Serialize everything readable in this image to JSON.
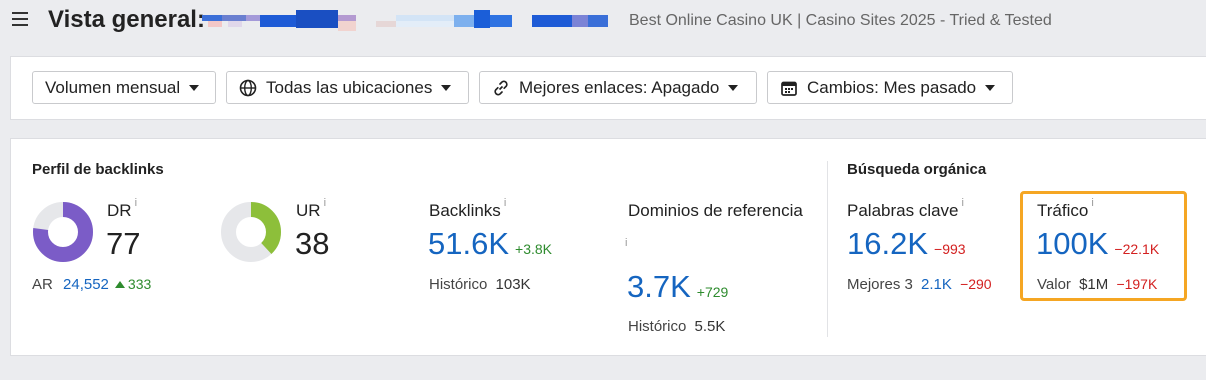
{
  "header": {
    "title": "Vista general:",
    "subtitle": "Best Online Casino UK | Casino Sites 2025 - Tried & Tested"
  },
  "filters": [
    {
      "label": "Volumen mensual",
      "icon": "none"
    },
    {
      "label": "Todas las ubicaciones",
      "icon": "globe-icon"
    },
    {
      "label": "Mejores enlaces: Apagado",
      "icon": "link-icon"
    },
    {
      "label": "Cambios: Mes pasado",
      "icon": "calendar-icon"
    }
  ],
  "backlinks_profile": {
    "title": "Perfil de backlinks",
    "info_glyph": "i",
    "dr": {
      "label": "DR",
      "value": "77",
      "fill_percent": 77,
      "color": "#7b5cc7"
    },
    "ur": {
      "label": "UR",
      "value": "38",
      "fill_percent": 38,
      "color": "#8dbf3a"
    },
    "ar": {
      "label": "AR",
      "value": "24,552",
      "delta": "333"
    },
    "backlinks": {
      "label": "Backlinks",
      "value": "51.6K",
      "delta": "+3.8K",
      "historic_label": "Histórico",
      "historic_value": "103K"
    },
    "ref_domains": {
      "label": "Dominios de referencia",
      "value": "3.7K",
      "delta": "+729",
      "historic_label": "Histórico",
      "historic_value": "5.5K"
    }
  },
  "organic_search": {
    "title": "Búsqueda orgánica",
    "keywords": {
      "label": "Palabras clave",
      "value": "16.2K",
      "delta": "−993",
      "top3_label": "Mejores 3",
      "top3_value": "2.1K",
      "top3_delta": "−290"
    },
    "traffic": {
      "label": "Tráfico",
      "value": "100K",
      "delta": "−22.1K",
      "value_label": "Valor",
      "value_amount": "$1M",
      "value_delta": "−197K"
    }
  },
  "colors": {
    "blue_value": "#1565c0",
    "green_delta": "#2e8b2e",
    "red_delta": "#d32020",
    "highlight_border": "#f5a623",
    "donut_track": "#e6e7ea"
  }
}
